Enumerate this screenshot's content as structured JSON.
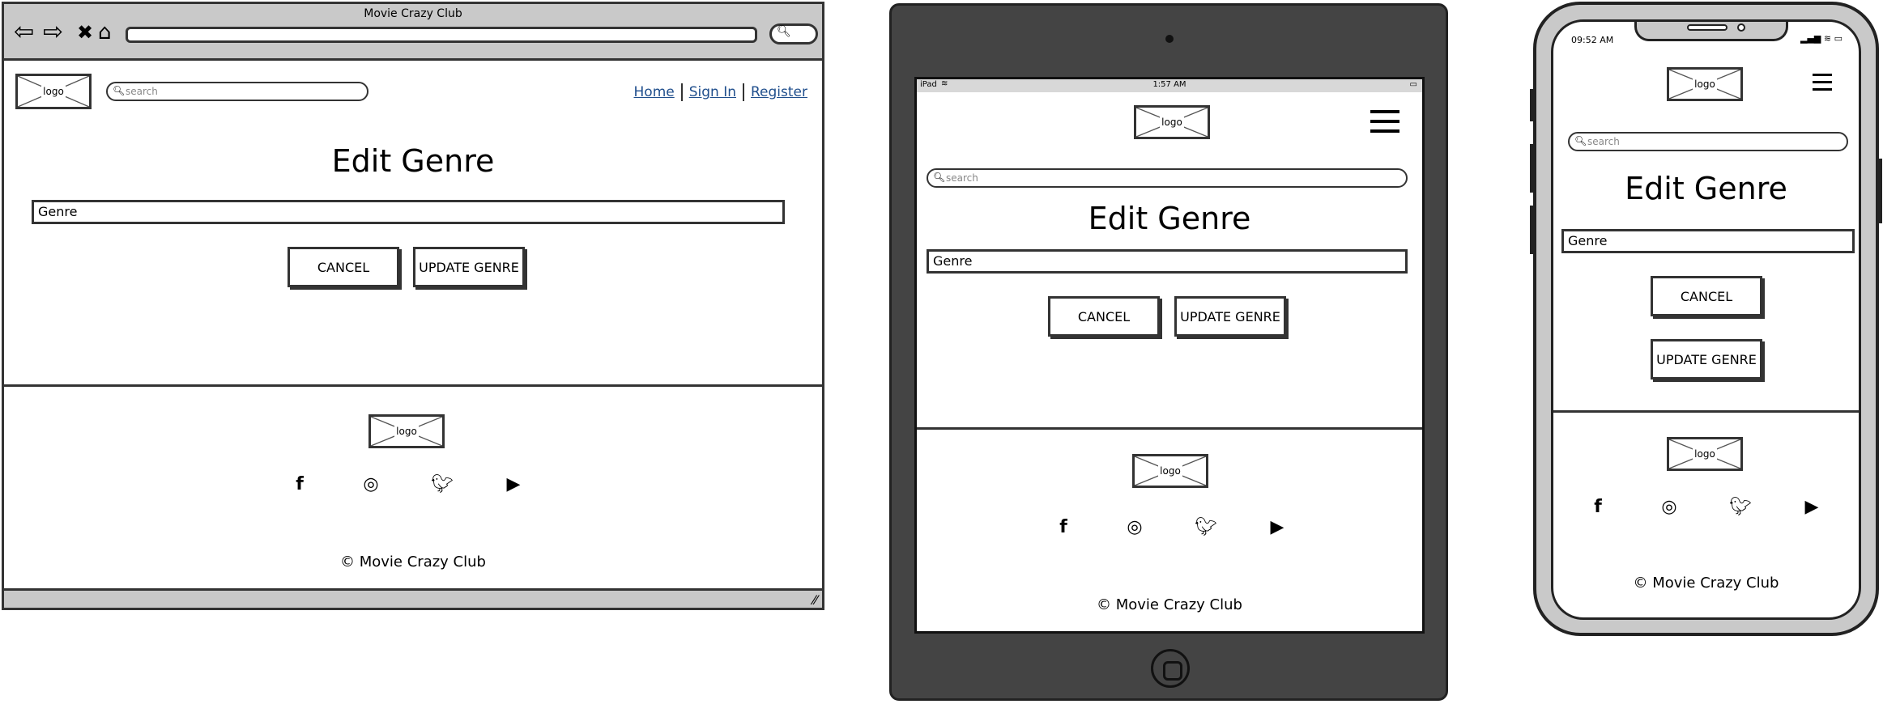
{
  "app_title": "Movie Crazy Club",
  "logo_label": "logo",
  "search_placeholder": "search",
  "nav": {
    "home": "Home",
    "sign_in": "Sign In",
    "register": "Register"
  },
  "page": {
    "title": "Edit Genre",
    "genre_field": "Genre",
    "cancel": "CANCEL",
    "update": "UPDATE GENRE"
  },
  "footer": {
    "copyright": "© Movie Crazy Club",
    "social_icons": [
      "facebook-icon",
      "instagram-icon",
      "twitter-icon",
      "youtube-icon"
    ]
  },
  "tablet_status": {
    "device": "iPad",
    "time": "1:57 AM"
  },
  "phone_status": {
    "time": "09:52 AM"
  },
  "colors": {
    "frame": "#333333",
    "chrome": "#c9c9c9",
    "tablet_body": "#444444",
    "link": "#1f4e8c"
  }
}
